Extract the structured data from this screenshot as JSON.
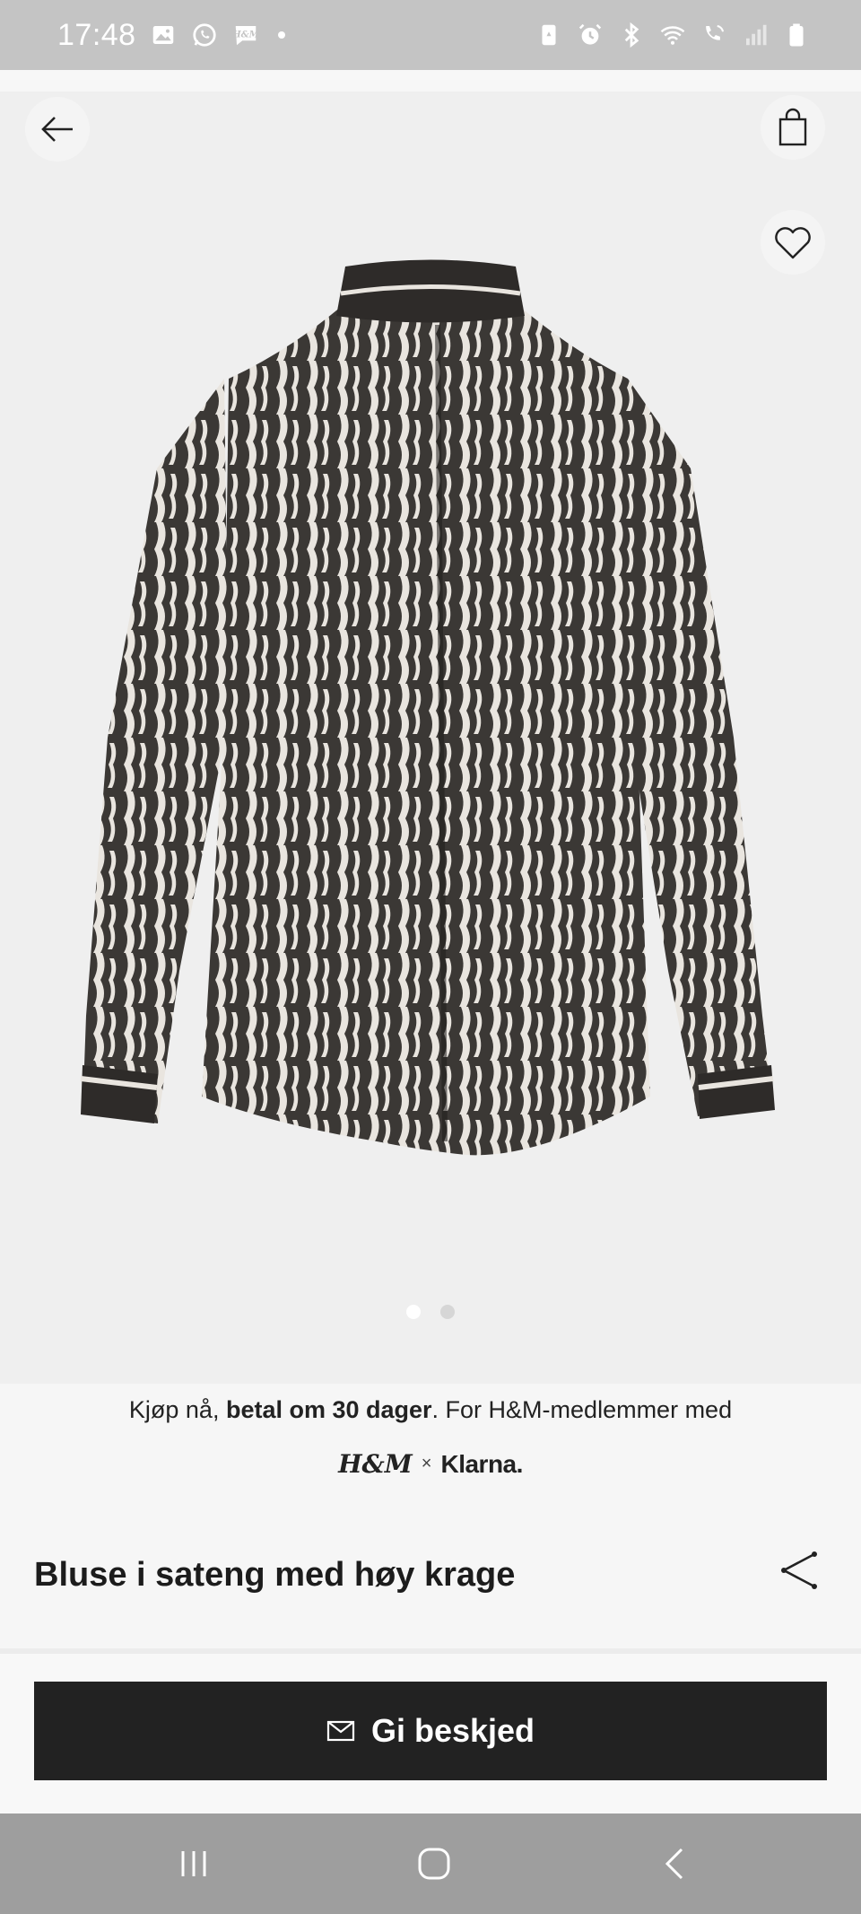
{
  "status_bar": {
    "time": "17:48",
    "left_icons": [
      "image-icon",
      "whatsapp-icon",
      "hm-app-icon",
      "dot-icon"
    ],
    "right_icons": [
      "battery-saver-icon",
      "alarm-icon",
      "bluetooth-icon",
      "wifi-icon",
      "wifi-calling-icon",
      "signal-icon",
      "battery-icon"
    ]
  },
  "header": {
    "back_icon": "arrow-left-icon",
    "cart_icon": "shopping-bag-icon",
    "favorite_icon": "heart-icon"
  },
  "gallery": {
    "image_alt": "Bluse i sateng med høy krage",
    "page_count": 2,
    "active_page": 1
  },
  "klarna_banner": {
    "text_before": "Kjøp nå, ",
    "text_bold": "betal om 30 dager",
    "text_after": ". For H&M-medlemmer med",
    "hm_logo": "H&M",
    "times": "×",
    "klarna_logo": "Klarna."
  },
  "product": {
    "title": "Bluse i sateng med høy krage",
    "share_icon": "share-icon"
  },
  "cta": {
    "icon": "envelope-icon",
    "label": "Gi beskjed"
  },
  "nav_bar": {
    "icons": [
      "recent-apps-icon",
      "home-icon",
      "back-icon"
    ]
  },
  "colors": {
    "cta_background": "#222222",
    "status_bar": "#c4c4c4",
    "nav_bar": "#9e9e9e"
  }
}
